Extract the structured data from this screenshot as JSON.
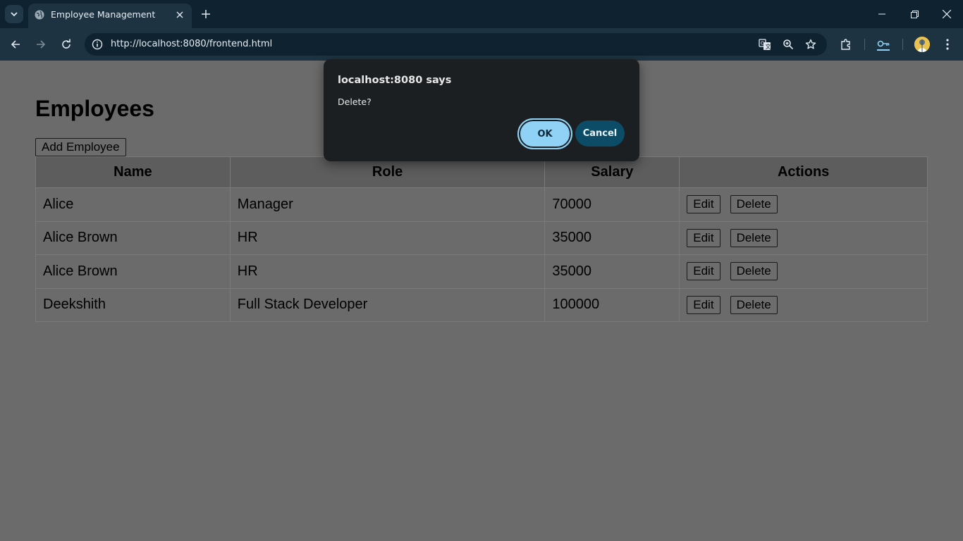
{
  "browser": {
    "tab_title": "Employee Management",
    "url": "http://localhost:8080/frontend.html"
  },
  "page": {
    "title": "Employees",
    "add_button": "Add Employee",
    "table": {
      "headers": [
        "Name",
        "Role",
        "Salary",
        "Actions"
      ],
      "rows": [
        {
          "name": "Alice",
          "role": "Manager",
          "salary": "70000"
        },
        {
          "name": "Alice Brown",
          "role": "HR",
          "salary": "35000"
        },
        {
          "name": "Alice Brown",
          "role": "HR",
          "salary": "35000"
        },
        {
          "name": "Deekshith",
          "role": "Full Stack Developer",
          "salary": "100000"
        }
      ],
      "edit_label": "Edit",
      "delete_label": "Delete"
    }
  },
  "dialog": {
    "title": "localhost:8080 says",
    "message": "Delete?",
    "ok_label": "OK",
    "cancel_label": "Cancel"
  }
}
